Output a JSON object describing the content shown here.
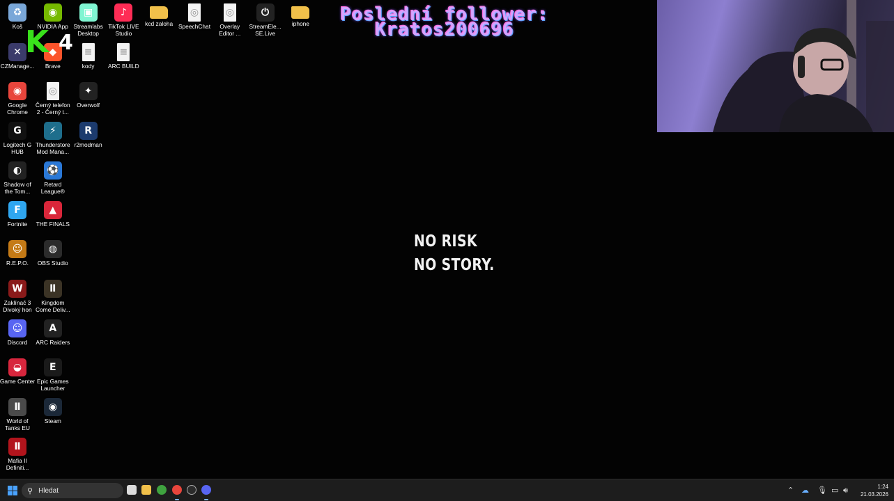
{
  "desktop": {
    "icons": [
      {
        "name": "recycle-bin-icon",
        "label": "Koš",
        "color": "#7aa7d8",
        "glyph": "♻"
      },
      {
        "name": "nvidia-app-icon",
        "label": "NVIDIA App",
        "color": "#76b900",
        "glyph": "◉"
      },
      {
        "name": "streamlabs-icon",
        "label": "Streamlabs Desktop",
        "color": "#80f5d2",
        "glyph": "▣"
      },
      {
        "name": "tiktok-live-icon",
        "label": "TikTok LIVE Studio",
        "color": "#fe2c55",
        "glyph": "♪"
      },
      {
        "name": "folder-icon",
        "label": "kcd zaloha",
        "color": "#f1c04a",
        "glyph": ""
      },
      {
        "name": "chrome-doc-icon",
        "label": "SpeechChat",
        "color": "#f3f3f3",
        "glyph": "◎"
      },
      {
        "name": "chrome-doc-icon",
        "label": "Overlay Editor ...",
        "color": "#f3f3f3",
        "glyph": "◎"
      },
      {
        "name": "streamelements-icon",
        "label": "StreamEle... SE.Live",
        "color": "#222222",
        "glyph": "⏻"
      },
      {
        "name": "folder-icon",
        "label": "iphone",
        "color": "#f1c04a",
        "glyph": ""
      },
      {
        "name": "czmanager-icon",
        "label": "CZManage...",
        "color": "#3b3b6b",
        "glyph": "✕"
      },
      {
        "name": "brave-icon",
        "label": "Brave",
        "color": "#fb542b",
        "glyph": "◆"
      },
      {
        "name": "text-file-icon",
        "label": "kody",
        "color": "#f3f3f3",
        "glyph": "≡"
      },
      {
        "name": "text-file-icon",
        "label": "ARC BUILD",
        "color": "#f3f3f3",
        "glyph": "≡"
      },
      {
        "name": "chrome-icon",
        "label": "Google Chrome",
        "color": "#e8453c",
        "glyph": "◉"
      },
      {
        "name": "chrome-doc-icon",
        "label": "Černý telefon 2 - Černý t...",
        "color": "#f3f3f3",
        "glyph": "◎"
      },
      {
        "name": "overwolf-icon",
        "label": "Overwolf",
        "color": "#222222",
        "glyph": "✦"
      },
      {
        "name": "logitech-ghub-icon",
        "label": "Logitech G HUB",
        "color": "#111111",
        "glyph": "G"
      },
      {
        "name": "thunderstore-icon",
        "label": "Thunderstore Mod Mana...",
        "color": "#1e6e8c",
        "glyph": "⚡"
      },
      {
        "name": "r2modman-icon",
        "label": "r2modman",
        "color": "#1c3b6e",
        "glyph": "R"
      },
      {
        "name": "shadow-tomb-raider-icon",
        "label": "Shadow of the Tom...",
        "color": "#222222",
        "glyph": "◐"
      },
      {
        "name": "rocket-league-icon",
        "label": "Retard League®",
        "color": "#2a78d6",
        "glyph": "⚽"
      },
      {
        "name": "fortnite-icon",
        "label": "Fortnite",
        "color": "#2fa6f0",
        "glyph": "F"
      },
      {
        "name": "the-finals-icon",
        "label": "THE FINALS",
        "color": "#d9263a",
        "glyph": "▲"
      },
      {
        "name": "repo-icon",
        "label": "R.E.P.O.",
        "color": "#c47a16",
        "glyph": "☺"
      },
      {
        "name": "obs-studio-icon",
        "label": "OBS Studio",
        "color": "#2b2b2b",
        "glyph": "◍"
      },
      {
        "name": "witcher3-icon",
        "label": "Zaklínač 3 Divoký hon",
        "color": "#8a1a1a",
        "glyph": "W"
      },
      {
        "name": "kingdom-come-icon",
        "label": "Kingdom Come Deliv...",
        "color": "#3b3325",
        "glyph": "Ⅱ"
      },
      {
        "name": "discord-icon",
        "label": "Discord",
        "color": "#5865f2",
        "glyph": "☺"
      },
      {
        "name": "arc-raiders-icon",
        "label": "ARC Raiders",
        "color": "#222222",
        "glyph": "A"
      },
      {
        "name": "game-center-icon",
        "label": "Game Center",
        "color": "#d7263d",
        "glyph": "◒"
      },
      {
        "name": "epic-games-icon",
        "label": "Epic Games Launcher",
        "color": "#1a1a1a",
        "glyph": "E"
      },
      {
        "name": "world-of-tanks-icon",
        "label": "World of Tanks EU",
        "color": "#4a4a4a",
        "glyph": "Ⅱ"
      },
      {
        "name": "steam-icon",
        "label": "Steam",
        "color": "#1b2838",
        "glyph": "◉"
      },
      {
        "name": "mafia2-icon",
        "label": "Mafia II Definiti...",
        "color": "#b2141c",
        "glyph": "Ⅱ"
      }
    ]
  },
  "overlay": {
    "follower_line1": "Poslední follower:",
    "follower_line2": "Kratos200696",
    "logo_letter": "K",
    "logo_number": "4",
    "tagline_line1": "NO RISK",
    "tagline_line2": "NO STORY."
  },
  "taskbar": {
    "search_placeholder": "Hledat",
    "time": "1:24",
    "date": "21.03.2026"
  }
}
